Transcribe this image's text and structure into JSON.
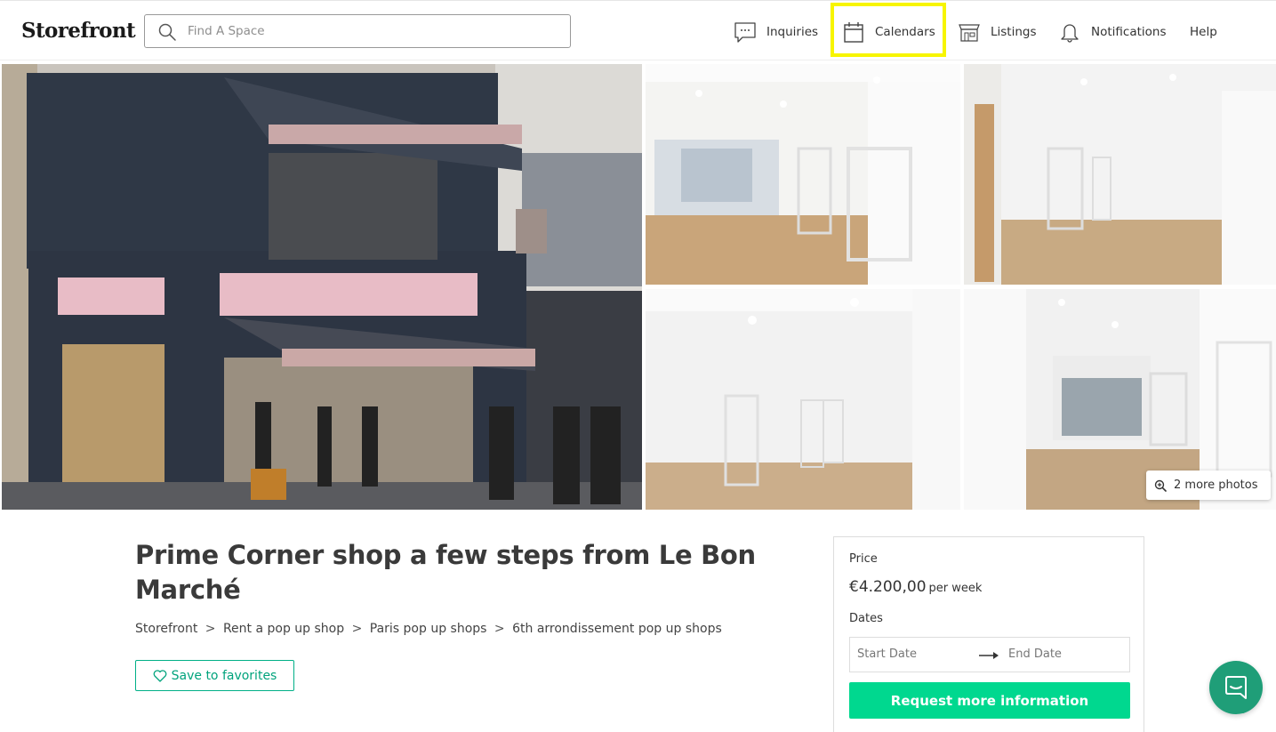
{
  "header": {
    "logo": "Storefront",
    "search": {
      "placeholder": "Find A Space",
      "value": ""
    },
    "nav": {
      "inquiries": "Inquiries",
      "calendars": "Calendars",
      "listings": "Listings",
      "notifications": "Notifications",
      "help": "Help"
    },
    "highlight_color": "#f7f500"
  },
  "gallery": {
    "more_photos": "2 more photos"
  },
  "listing": {
    "title": "Prime Corner shop a few steps from Le Bon Marché",
    "breadcrumb": [
      "Storefront",
      "Rent a pop up shop",
      "Paris pop up shops",
      "6th arrondissement pop up shops"
    ],
    "breadcrumb_separator": ">",
    "save_label": "Save to favorites"
  },
  "booking": {
    "price_label": "Price",
    "price": "€4.200,00",
    "price_unit": "per week",
    "dates_label": "Dates",
    "start_date_placeholder": "Start Date",
    "end_date_placeholder": "End Date",
    "request_label": "Request more information",
    "accent_color": "#00d88f"
  },
  "icons": [
    "search-icon",
    "chat-bubble-icon",
    "calendar-icon",
    "storefront-icon",
    "bell-icon",
    "zoom-icon",
    "heart-icon",
    "arrow-right-icon",
    "chat-icon"
  ]
}
